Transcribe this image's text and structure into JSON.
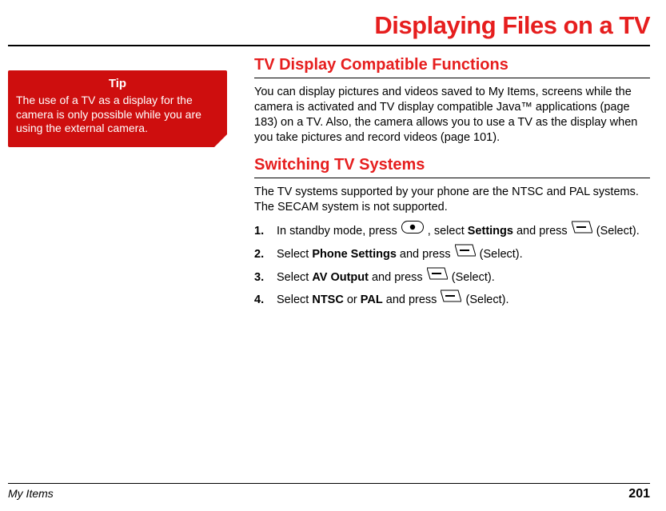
{
  "page": {
    "title": "Displaying Files on a TV",
    "footer_section": "My Items",
    "footer_page": "201"
  },
  "tip": {
    "title": "Tip",
    "body": "The use of a TV as a display for the camera is only possible while you are using the external camera."
  },
  "main": {
    "s1_title": "TV Display Compatible Functions",
    "s1_body": "You can display pictures and videos saved to My Items, screens while the camera is activated and TV display compatible Java™ applications (page 183) on a TV. Also, the camera allows you to use a TV as the display when you take pictures and record videos (page 101).",
    "s2_title": "Switching TV Systems",
    "s2_body": "The TV systems supported by your phone are the NTSC and PAL systems. The SECAM system is not supported.",
    "steps": {
      "st1a": "In standby mode, press ",
      "st1b": ", select ",
      "st1c": "Settings",
      "st1d": " and press ",
      "st1e": " (Select).",
      "st2a": "Select ",
      "st2b": "Phone Settings",
      "st2c": " and press ",
      "st2d": " (Select).",
      "st3a": "Select ",
      "st3b": "AV Output",
      "st3c": " and press ",
      "st3d": " (Select).",
      "st4a": "Select ",
      "st4b": "NTSC",
      "st4c": " or ",
      "st4d": "PAL",
      "st4e": " and press ",
      "st4f": " (Select)."
    }
  }
}
